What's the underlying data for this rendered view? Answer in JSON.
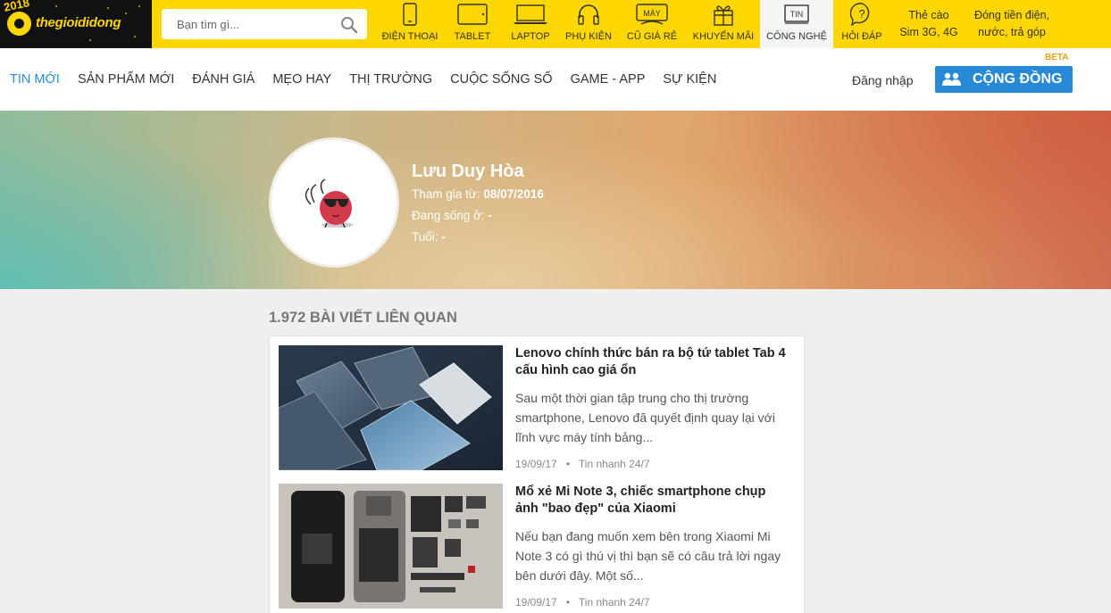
{
  "header": {
    "logo": {
      "year": "2018",
      "brand": "thegioididong"
    },
    "search": {
      "placeholder": "Bạn tìm gì..."
    },
    "nav": [
      {
        "label": "ĐIỆN THOẠI",
        "icon": "phone-icon"
      },
      {
        "label": "TABLET",
        "icon": "tablet-icon"
      },
      {
        "label": "LAPTOP",
        "icon": "laptop-icon"
      },
      {
        "label": "PHỤ KIỆN",
        "icon": "headphones-icon"
      },
      {
        "label": "CŨ GIÁ RẺ",
        "icon": "old-device-icon",
        "badge": "MÁY"
      },
      {
        "label": "KHUYẾN MÃI",
        "icon": "gift-icon"
      },
      {
        "label": "CÔNG NGHỆ",
        "icon": "news-icon",
        "badge": "TIN"
      },
      {
        "label": "HỎI ĐÁP",
        "icon": "question-icon"
      }
    ],
    "extra": [
      {
        "line1": "Thẻ cào",
        "line2": "Sim 3G, 4G"
      },
      {
        "line1": "Đóng tiền điện,",
        "line2": "nước, trả góp"
      }
    ]
  },
  "categories": {
    "items": [
      "TIN MỚI",
      "SẢN PHẨM MỚI",
      "ĐÁNH GIÁ",
      "MẸO HAY",
      "THỊ TRƯỜNG",
      "CUỘC SỐNG SỐ",
      "GAME - APP",
      "SỰ KIỆN"
    ],
    "active_index": 0,
    "login": "Đăng nhập",
    "beta": "BETA",
    "community": "CỘNG ĐỒNG"
  },
  "profile": {
    "name": "Lưu Duy Hòa",
    "joined_label": "Tham gia từ: ",
    "joined_value": "08/07/2016",
    "location_label": "Đang sống ở: ",
    "location_value": "-",
    "age_label": "Tuổi: ",
    "age_value": "-"
  },
  "articles_section": {
    "count_title": "1.972 BÀI VIẾT LIÊN QUAN",
    "items": [
      {
        "title": "Lenovo chính thức bán ra bộ tứ tablet Tab 4 cấu hình cao giá ổn",
        "desc": "Sau một thời gian tập trung cho thị trường smartphone, Lenovo đã quyết định quay lại với lĩnh vực máy tính bảng...",
        "date": "19/09/17",
        "category": "Tin nhanh 24/7"
      },
      {
        "title": "Mổ xẻ Mi Note 3, chiếc smartphone chụp ảnh \"bao đẹp\" của Xiaomi",
        "desc": "Nếu bạn đang muốn xem bên trong Xiaomi Mi Note 3 có gì thú vị thì bạn sẽ có câu trả lời ngay bên dưới đây. Một số...",
        "date": "19/09/17",
        "category": "Tin nhanh 24/7"
      }
    ]
  },
  "colors": {
    "brand_yellow": "#fed700",
    "accent_blue": "#288ad6",
    "beta_orange": "#e8a21b"
  }
}
